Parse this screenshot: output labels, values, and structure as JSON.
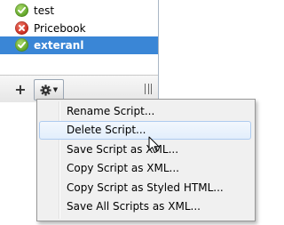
{
  "scripts": [
    {
      "name": "test",
      "status": "valid",
      "status_icon": "check-icon"
    },
    {
      "name": "Pricebook",
      "status": "error",
      "status_icon": "x-icon"
    },
    {
      "name": "exteranl",
      "status": "valid",
      "status_icon": "check-icon",
      "selected": true
    }
  ],
  "toolbar": {
    "add_label": "+",
    "gear_icon": "gear-icon",
    "dropdown_icon": "chevron-down-icon"
  },
  "context_menu": {
    "items": [
      {
        "label": "Rename Script..."
      },
      {
        "label": "Delete Script...",
        "hovered": true
      },
      {
        "label": "Save Script as XML..."
      },
      {
        "label": "Copy Script as XML..."
      },
      {
        "label": "Copy Script as Styled HTML..."
      },
      {
        "label": "Save All Scripts as XML..."
      }
    ]
  },
  "colors": {
    "selection": "#3a86d6",
    "valid": "#5ca225",
    "error": "#c7281c",
    "menu_hover": "#e2eefc"
  }
}
